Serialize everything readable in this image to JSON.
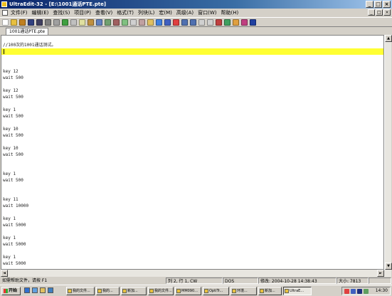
{
  "window": {
    "title": "UltraEdit-32 - [E:\\1001通话PTE.pte]",
    "min": "_",
    "max": "□",
    "close": "×"
  },
  "menu": {
    "items": [
      "文件(F)",
      "编辑(E)",
      "查找(S)",
      "项目(P)",
      "查看(V)",
      "格式(T)",
      "列块(L)",
      "宏(M)",
      "高级(A)",
      "窗口(W)",
      "帮助(H)"
    ],
    "mdi_min": "_",
    "mdi_max": "□",
    "mdi_close": "×"
  },
  "toolbar": {
    "icons": [
      {
        "name": "new-file-icon",
        "color": "#ffffff"
      },
      {
        "name": "open-file-icon",
        "color": "#e8c040"
      },
      {
        "name": "close-file-icon",
        "color": "#c08020"
      },
      {
        "name": "save-icon",
        "color": "#304080"
      },
      {
        "name": "save-as-icon",
        "color": "#404060"
      },
      {
        "name": "print-icon",
        "color": "#808080"
      },
      {
        "name": "print-preview-icon",
        "color": "#a0a0a0"
      },
      {
        "name": "ftp-icon",
        "color": "#40a040"
      },
      {
        "name": "cut-icon",
        "color": "#c0c0c0"
      },
      {
        "name": "copy-icon",
        "color": "#e0e0a0"
      },
      {
        "name": "paste-icon",
        "color": "#c09040"
      },
      {
        "name": "word-wrap-icon",
        "color": "#6080c0"
      },
      {
        "name": "column-mode-icon",
        "color": "#70a070"
      },
      {
        "name": "hex-mode-icon",
        "color": "#a06060"
      },
      {
        "name": "tag-list-icon",
        "color": "#80c080"
      },
      {
        "name": "find-icon",
        "color": "#d0d0d0"
      },
      {
        "name": "replace-icon",
        "color": "#c0a0a0"
      },
      {
        "name": "find-files-icon",
        "color": "#e0c060"
      },
      {
        "name": "bookmark-icon",
        "color": "#4080e0"
      },
      {
        "name": "next-bookmark-icon",
        "color": "#4060c0"
      },
      {
        "name": "spell-check-icon",
        "color": "#e04040"
      },
      {
        "name": "undo-icon",
        "color": "#5070b0"
      },
      {
        "name": "redo-icon",
        "color": "#5070b0"
      },
      {
        "name": "uppercase-icon",
        "color": "#d0d0d0"
      },
      {
        "name": "lowercase-icon",
        "color": "#d0d0d0"
      },
      {
        "name": "macro-record-icon",
        "color": "#c04040"
      },
      {
        "name": "macro-play-icon",
        "color": "#40a060"
      },
      {
        "name": "tools-icon",
        "color": "#e0a040"
      },
      {
        "name": "compare-icon",
        "color": "#c04080"
      },
      {
        "name": "help-icon",
        "color": "#2040a0"
      }
    ]
  },
  "tab": {
    "label": "1001通话PTE.pte"
  },
  "editor": {
    "lines": [
      {
        "row": 0,
        "text": "//100次的1001通话测试。"
      },
      {
        "row": 4,
        "text": "key 12"
      },
      {
        "row": 5,
        "text": "wait 500"
      },
      {
        "row": 7,
        "text": "key 12"
      },
      {
        "row": 8,
        "text": "wait 500"
      },
      {
        "row": 10,
        "text": "key 1"
      },
      {
        "row": 11,
        "text": "wait 500"
      },
      {
        "row": 13,
        "text": "key 10"
      },
      {
        "row": 14,
        "text": "wait 500"
      },
      {
        "row": 16,
        "text": "key 10"
      },
      {
        "row": 17,
        "text": "wait 500"
      },
      {
        "row": 20,
        "text": "key 1"
      },
      {
        "row": 21,
        "text": "wait 500"
      },
      {
        "row": 24,
        "text": "key 11"
      },
      {
        "row": 25,
        "text": "wait 10000"
      },
      {
        "row": 27,
        "text": "key 1"
      },
      {
        "row": 28,
        "text": "wait 5000"
      },
      {
        "row": 30,
        "text": "key 1"
      },
      {
        "row": 31,
        "text": "wait 5000"
      },
      {
        "row": 33,
        "text": "key 1"
      },
      {
        "row": 34,
        "text": "wait 5000"
      },
      {
        "row": 36,
        "text": "key 1"
      }
    ]
  },
  "scroll": {
    "up": "▲",
    "down": "▼",
    "left": "◄",
    "right": "►"
  },
  "status": {
    "help": "如需帮助文件，请按 F1",
    "position": "列 2, 行 1, CW",
    "format": "DOS",
    "modified": "修改: 2004-10-28 14:38:43",
    "size": "大小: 7813"
  },
  "taskbar": {
    "start": "开始",
    "tasks": [
      "我的文件...",
      "我的...",
      "新加...",
      "我的文件...",
      "MM090...",
      "OptiTr...",
      "环境...",
      "新加...",
      "UltraE..."
    ],
    "clock": "14:30"
  }
}
